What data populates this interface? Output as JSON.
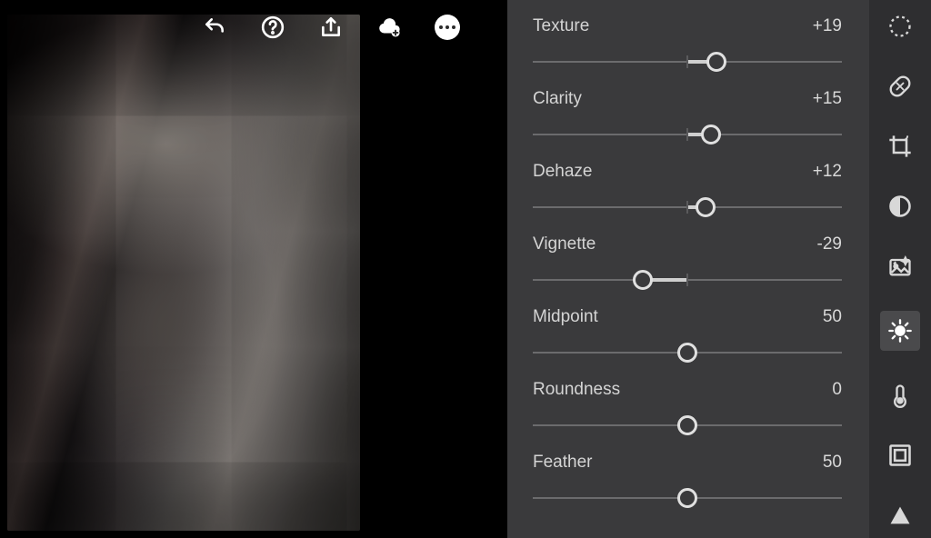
{
  "sliders": [
    {
      "label": "Texture",
      "value": "+19",
      "pos": 59.5,
      "zero": 50,
      "fillFrom": 50,
      "fillTo": 59.5
    },
    {
      "label": "Clarity",
      "value": "+15",
      "pos": 57.5,
      "zero": 50,
      "fillFrom": 50,
      "fillTo": 57.5
    },
    {
      "label": "Dehaze",
      "value": "+12",
      "pos": 56,
      "zero": 50,
      "fillFrom": 50,
      "fillTo": 56
    },
    {
      "label": "Vignette",
      "value": "-29",
      "pos": 35.5,
      "zero": 50,
      "fillFrom": 35.5,
      "fillTo": 50
    },
    {
      "label": "Midpoint",
      "value": "50",
      "pos": 50,
      "zero": null
    },
    {
      "label": "Roundness",
      "value": "0",
      "pos": 50,
      "zero": 50
    },
    {
      "label": "Feather",
      "value": "50",
      "pos": 50,
      "zero": null
    }
  ],
  "toolbar_icons": [
    "undo-icon",
    "help-icon",
    "share-icon",
    "cloud-add-icon",
    "more-icon"
  ],
  "rail_icons": [
    "select-mask-icon",
    "healing-icon",
    "crop-icon",
    "presets-icon",
    "auto-icon",
    "light-icon",
    "temperature-icon",
    "optics-icon",
    "geometry-icon"
  ],
  "active_rail": "light-icon"
}
